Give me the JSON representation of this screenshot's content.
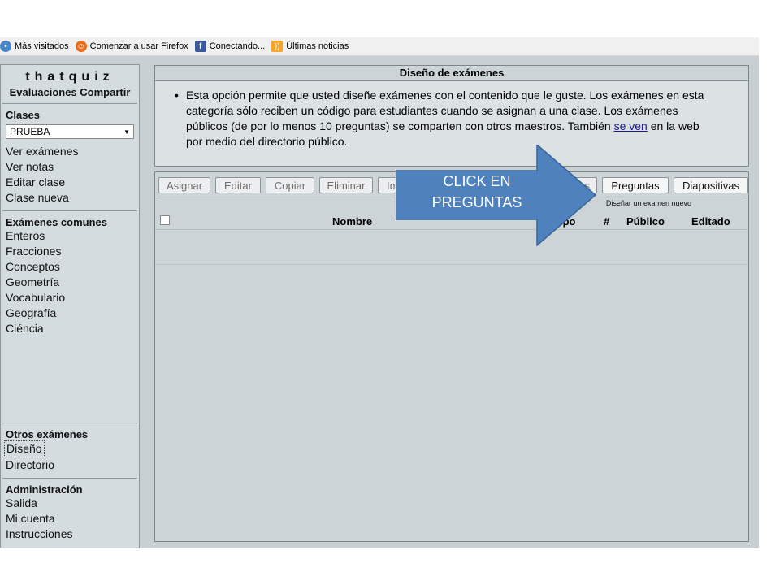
{
  "bookmarks": [
    {
      "label": "Más visitados",
      "icon": "globe-icon"
    },
    {
      "label": "Comenzar a usar Firefox",
      "icon": "firefox-icon"
    },
    {
      "label": "Conectando...",
      "icon": "facebook-icon"
    },
    {
      "label": "Últimas noticias",
      "icon": "rss-icon"
    }
  ],
  "sidebar": {
    "logo": "thatquiz",
    "tagline": "Evaluaciones Compartir",
    "classes_title": "Clases",
    "class_select": "PRUEBA",
    "class_links": [
      "Ver exámenes",
      "Ver notas",
      "Editar clase",
      "Clase nueva"
    ],
    "common_title": "Exámenes comunes",
    "common_links": [
      "Enteros",
      "Fracciones",
      "Conceptos",
      "Geometría",
      "Vocabulario",
      "Geografía",
      "Ciéncia"
    ],
    "other_title": "Otros exámenes",
    "other_links": [
      "Diseño",
      "Directorio"
    ],
    "admin_title": "Administración",
    "admin_links": [
      "Salida",
      "Mi cuenta",
      "Instrucciones"
    ]
  },
  "info_panel": {
    "title": "Diseño de exámenes",
    "text_before_link": "Esta opción permite que usted diseñe exámenes con el contenido que le guste. Los exámenes en esta categoría sólo reciben un código para estudiantes cuando se asignan a una clase. Los exámenes públicos (de por lo menos 10 preguntas) se comparten con otros maestros. También ",
    "link": "se ven",
    "text_after_link": " en la web por medio del directorio público."
  },
  "toolbar": {
    "asignar": "Asignar",
    "editar": "Editar",
    "copiar": "Copiar",
    "eliminar": "Eliminar",
    "im_partial": "Im",
    "as_partial": "as",
    "preguntas": "Preguntas",
    "diapositivas": "Diapositivas",
    "hint": "Diseñar un examen nuevo"
  },
  "table": {
    "col_nombre": "Nombre",
    "col_tipo_partial": "ipo",
    "col_num": "#",
    "col_publico": "Público",
    "col_editado": "Editado"
  },
  "callout": {
    "text_line1": "CLICK EN",
    "text_line2": "PREGUNTAS",
    "color": "#4f81bd"
  }
}
